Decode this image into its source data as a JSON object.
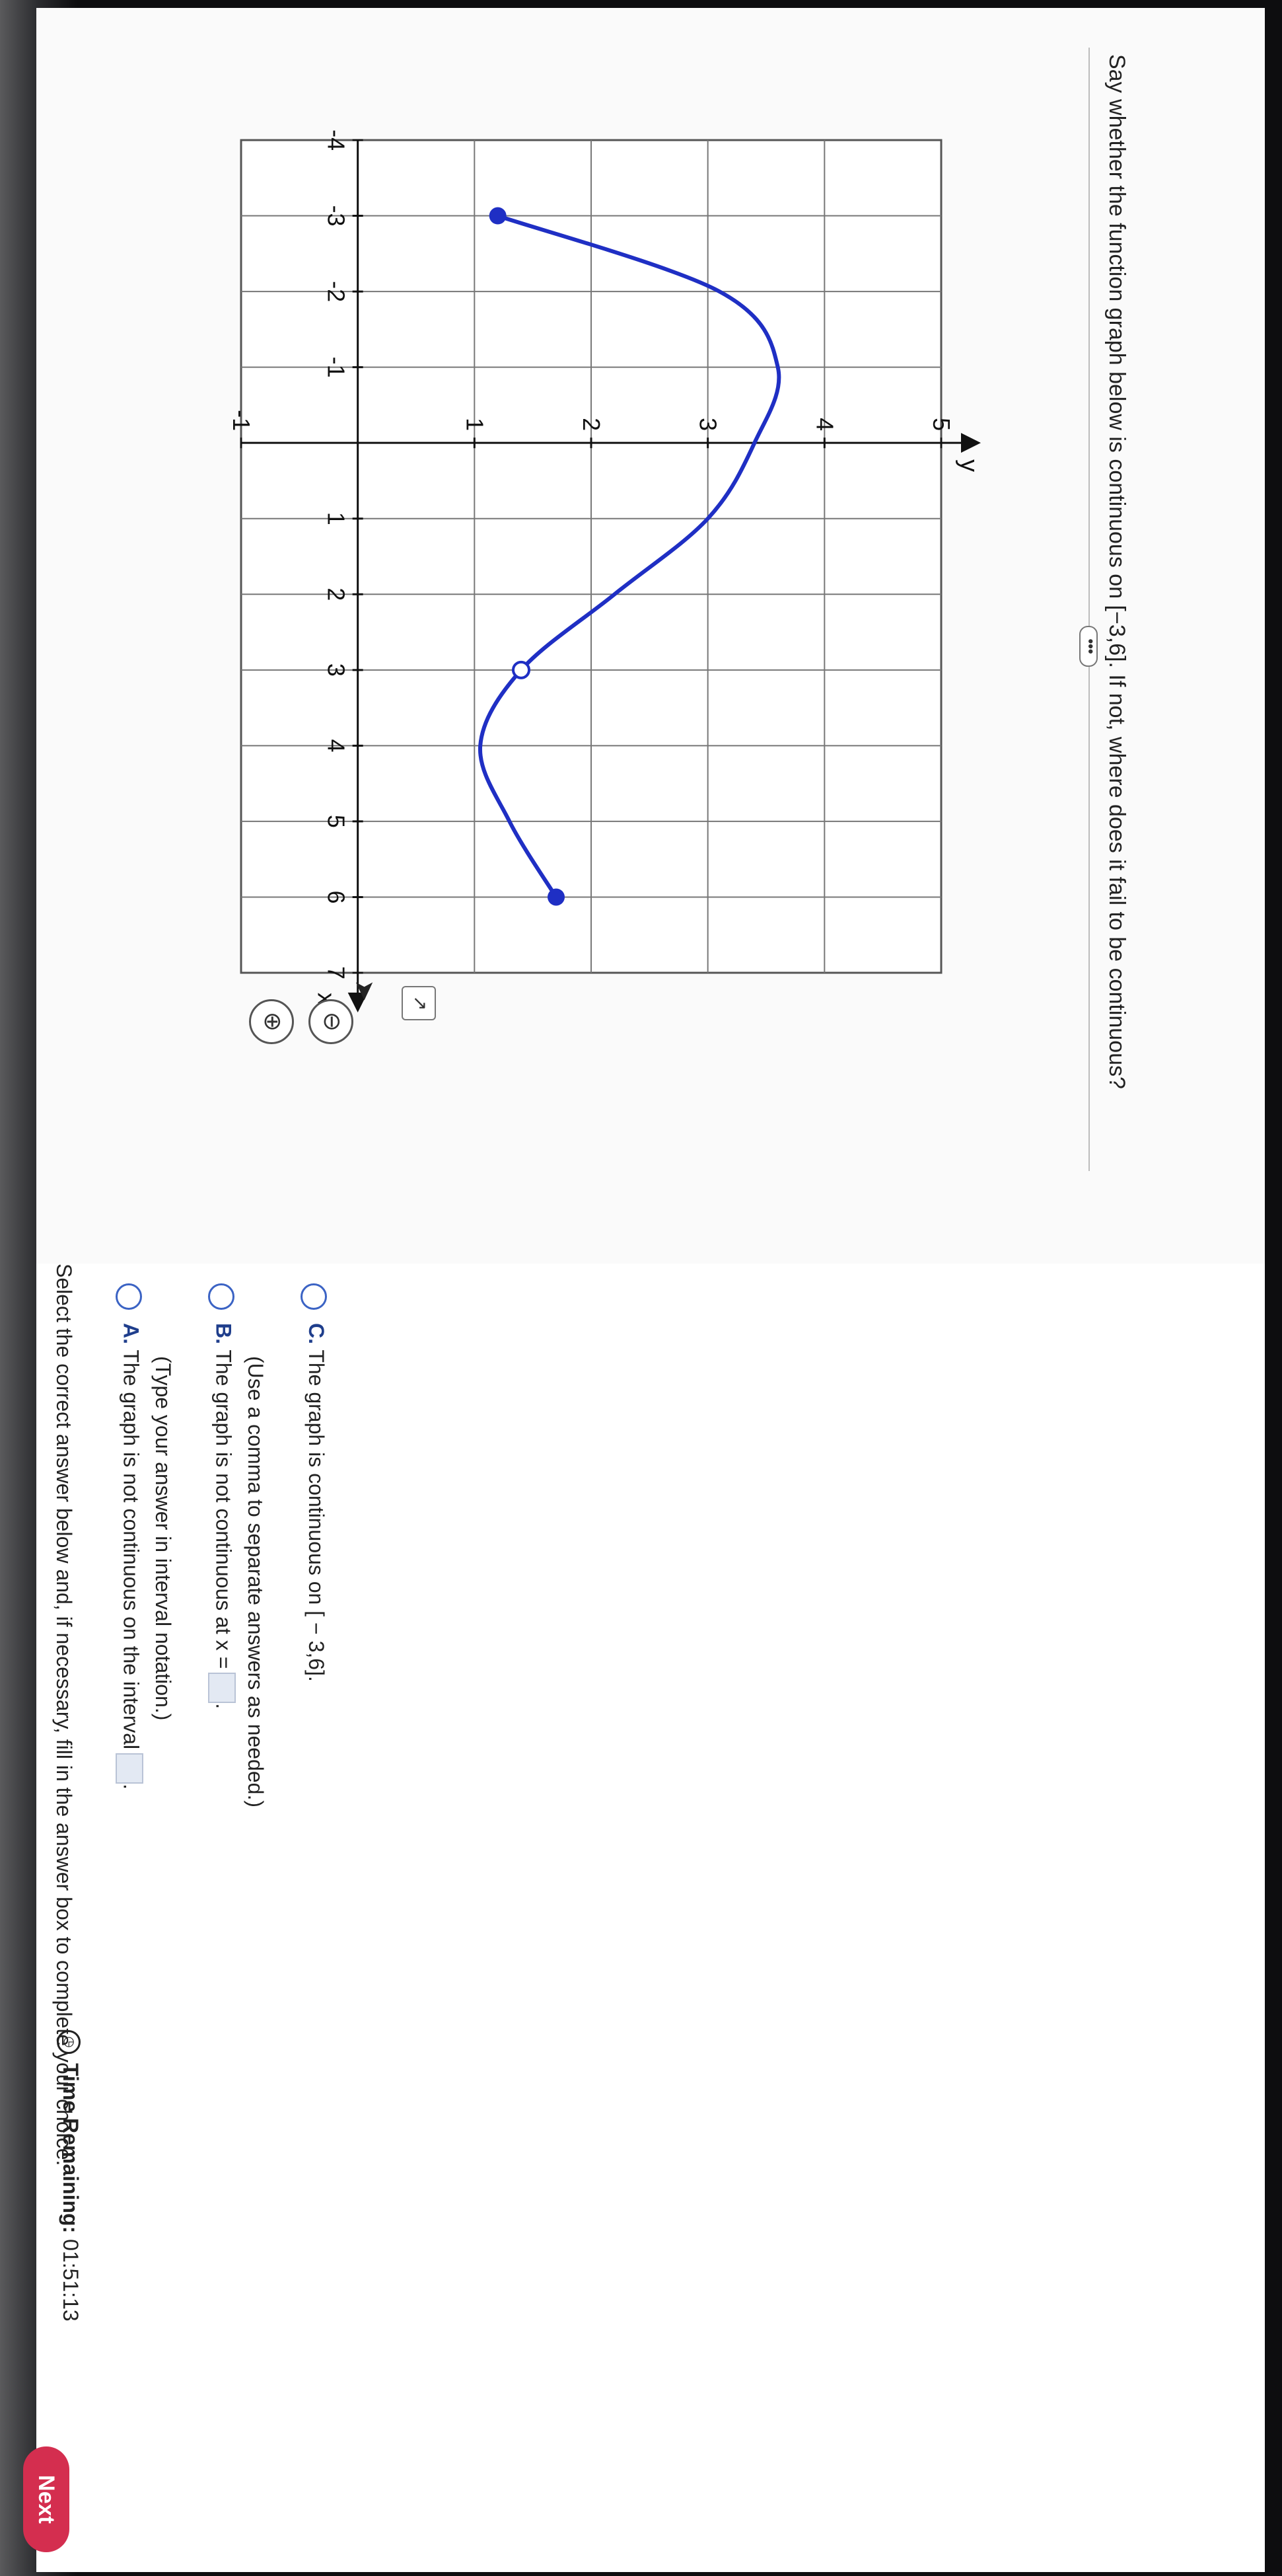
{
  "question": {
    "text": "Say whether the function graph below is continuous on [−3,6]. If not, where does it fail to be continuous?"
  },
  "instructions": "Select the correct answer below and, if necessary, fill in the answer box to complete your choice.",
  "choices": [
    {
      "letter": "A.",
      "line1": "The graph is not continuous on the interval",
      "line1_suffix": ".",
      "line2": "(Type your answer in interval notation.)"
    },
    {
      "letter": "B.",
      "line1": "The graph is not continuous at x =",
      "line1_suffix": ".",
      "line2": "(Use a comma to separate answers as needed.)"
    },
    {
      "letter": "C.",
      "line1": "The graph is continuous on [ − 3,6].",
      "line1_suffix": "",
      "line2": ""
    }
  ],
  "timer": {
    "label": "Time Remaining:",
    "value": "01:51:13"
  },
  "buttons": {
    "next": "Next",
    "more": "•••"
  },
  "icons": {
    "zoom_in": "zoom-in-icon",
    "zoom_out": "zoom-out-icon",
    "popout": "popout-icon",
    "clock": "clock-icon"
  },
  "colors": {
    "curve": "#1f2fc4",
    "radio": "#3b63c4",
    "next": "#d42e4f"
  },
  "chart_data": {
    "type": "line",
    "xlabel": "x",
    "ylabel": "y",
    "xlim": [
      -4,
      7
    ],
    "ylim": [
      -1,
      5
    ],
    "x_ticks": [
      "-4",
      "-3",
      "-2",
      "-1",
      "1",
      "2",
      "3",
      "4",
      "5",
      "6",
      "7"
    ],
    "y_ticks": [
      "-1",
      "1",
      "2",
      "3",
      "4",
      "5"
    ],
    "grid": true,
    "series": [
      {
        "points": [
          [
            -3,
            1.2
          ],
          [
            -2,
            3.1
          ],
          [
            -1,
            3.6
          ],
          [
            0,
            3.4
          ],
          [
            1,
            3.0
          ],
          [
            2,
            2.2
          ],
          [
            3,
            1.4
          ],
          [
            4,
            1.05
          ],
          [
            5,
            1.3
          ],
          [
            6,
            1.7
          ]
        ],
        "closed_points": [
          [
            -3,
            1.2
          ],
          [
            6,
            1.7
          ]
        ],
        "open_points": [
          [
            3,
            1.4
          ]
        ]
      }
    ]
  }
}
